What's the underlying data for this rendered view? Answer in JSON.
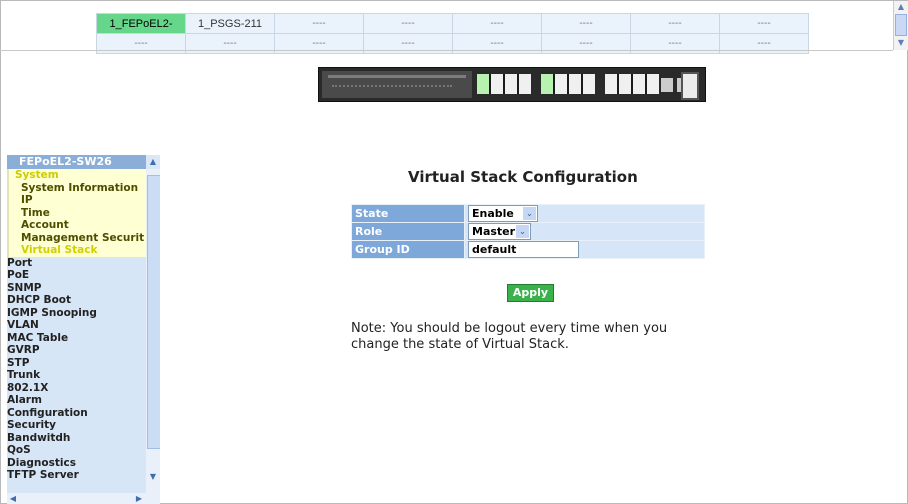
{
  "stack_grid": {
    "row1": [
      "1_FEPoEL2-",
      "1_PSGS-211",
      "----",
      "----",
      "----",
      "----",
      "----",
      "----"
    ],
    "row2": [
      "----",
      "----",
      "----",
      "----",
      "----",
      "----",
      "----",
      "----"
    ],
    "active_index": 0
  },
  "menu": {
    "header": "FEPoEL2-SW26",
    "system": "System",
    "system_items": [
      "System Information",
      "IP",
      "Time",
      "Account",
      "Management Securit",
      "Virtual Stack"
    ],
    "selected": "Virtual Stack",
    "items": [
      "Port",
      "PoE",
      "SNMP",
      "DHCP Boot",
      "IGMP Snooping",
      "VLAN",
      "MAC Table",
      "GVRP",
      "STP",
      "Trunk",
      "802.1X",
      "Alarm",
      "Configuration",
      "Security",
      "Bandwitdh",
      "QoS",
      "Diagnostics",
      "TFTP Server"
    ]
  },
  "page": {
    "title": "Virtual Stack Configuration",
    "rows": [
      {
        "label": "State",
        "type": "select",
        "value": "Enable"
      },
      {
        "label": "Role",
        "type": "select",
        "value": "Master"
      },
      {
        "label": "Group ID",
        "type": "text",
        "value": "default"
      }
    ],
    "apply_label": "Apply",
    "note": "Note: You should be logout every time when you change the state of Virtual Stack."
  },
  "colors": {
    "active_cell": "#66d68a",
    "label_cell": "#7ea8d9",
    "apply_button": "#3ab14a",
    "menu_bg": "#d7e6f7",
    "system_bg": "#ffffd4"
  },
  "icons": {
    "scroll_up": "▲",
    "scroll_down": "▼",
    "scroll_left": "◀",
    "scroll_right": "▶",
    "select_arrow": "⌄"
  }
}
